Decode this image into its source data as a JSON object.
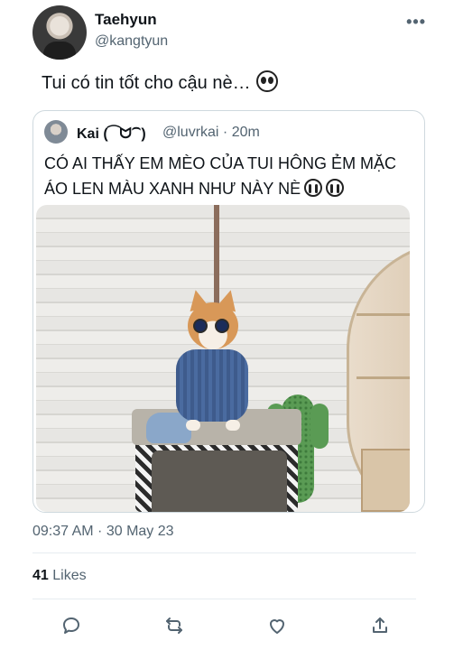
{
  "tweet": {
    "display_name": "Taehyun",
    "handle": "@kangtyun",
    "text": "Tui có tin tốt cho cậu nè…",
    "timestamp": "09:37 AM · 30 May 23",
    "likes_count": "41",
    "likes_label": "Likes"
  },
  "quoted": {
    "display_name": "Kai (⁀ᗢ⁀)",
    "handle_time": "@luvrkai · 20m",
    "text": "CÓ AI THẤY EM MÈO CỦA TUI HÔNG ẺM MẶC ÁO LEN MÀU XANH NHƯ NÀY NÈ"
  },
  "icons": {
    "more": "more-icon",
    "reply": "reply-icon",
    "retweet": "retweet-icon",
    "like": "like-icon",
    "share": "share-icon"
  },
  "colors": {
    "text": "#0f1419",
    "secondary": "#536471",
    "border": "#cfd9de"
  }
}
